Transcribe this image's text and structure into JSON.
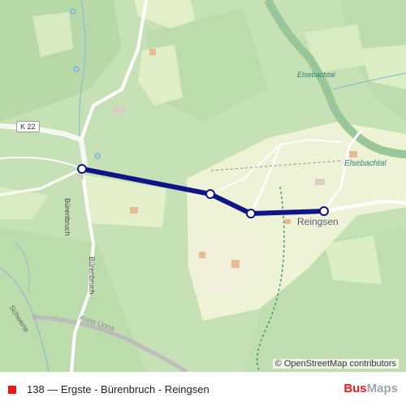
{
  "map": {
    "road_labels": {
      "k22": "K 22",
      "buerenbruch_street_1": "Bürenbruch",
      "buerenbruch_street_2": "Bürenbruch",
      "schwerte": "Schwerte",
      "kreis_unna": "Kreis Unna"
    },
    "place_labels": {
      "reingsen": "Reingsen",
      "elsebachtal_1": "Elsebachtal",
      "elsebachtal_2": "Elsebachtal"
    },
    "route": {
      "color": "#101585",
      "stop_count": 4
    },
    "attribution": "© OpenStreetMap contributors"
  },
  "footer": {
    "route_color": "#e8191c",
    "route_title": "138 — Ergste - Bürenbruch - Reingsen",
    "brand_part1": "Bus",
    "brand_part2": "Maps"
  }
}
